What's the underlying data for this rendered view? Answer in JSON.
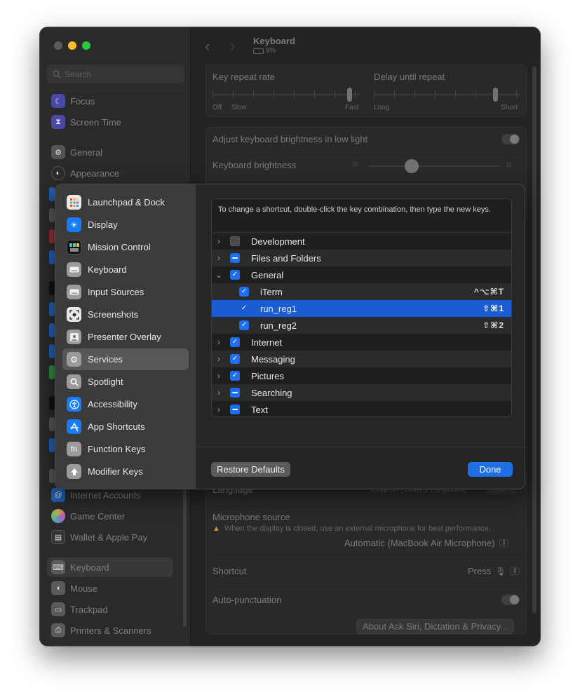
{
  "window": {
    "title": "Keyboard",
    "battery": "9%",
    "search_placeholder": "Search"
  },
  "sidebar": {
    "items": [
      {
        "label": "Focus",
        "icon": "moon-icon",
        "color": "#5e5ce6"
      },
      {
        "label": "Screen Time",
        "icon": "hourglass-icon",
        "color": "#5e5ce6"
      },
      {
        "label": "General",
        "icon": "gear-icon",
        "color": "#8e8e93"
      },
      {
        "label": "Appearance",
        "icon": "appearance-icon",
        "color": "#1c1c1e"
      },
      {
        "label": "Internet Accounts",
        "icon": "at-icon",
        "color": "#0a84ff"
      },
      {
        "label": "Game Center",
        "icon": "game-center-icon",
        "color": "#ff9f0a"
      },
      {
        "label": "Wallet & Apple Pay",
        "icon": "wallet-icon",
        "color": "#1c1c1e"
      },
      {
        "label": "Keyboard",
        "icon": "keyboard-icon",
        "color": "#8e8e93"
      },
      {
        "label": "Mouse",
        "icon": "mouse-icon",
        "color": "#8e8e93"
      },
      {
        "label": "Trackpad",
        "icon": "trackpad-icon",
        "color": "#8e8e93"
      },
      {
        "label": "Printers & Scanners",
        "icon": "printer-icon",
        "color": "#8e8e93"
      }
    ]
  },
  "keyboard": {
    "key_repeat_label": "Key repeat rate",
    "delay_label": "Delay until repeat",
    "repeat_min_1": "Off",
    "repeat_min_2": "Slow",
    "repeat_max": "Fast",
    "delay_min": "Long",
    "delay_max": "Short",
    "key_repeat_rate": 0.93,
    "delay_until_repeat": 0.83,
    "adjust_brightness_label": "Adjust keyboard brightness in low light",
    "adjust_brightness_on": false,
    "brightness_label": "Keyboard brightness",
    "keyboard_brightness": 0.33,
    "language_label": "Language",
    "language_value": "English (United Kingdom)",
    "language_button": "Edit...",
    "mic_source_label": "Microphone source",
    "mic_warning": "When the display is closed, use an external microphone for best performance.",
    "mic_source_value": "Automatic (MacBook Air Microphone)",
    "shortcut_label": "Shortcut",
    "shortcut_value": "Press",
    "auto_punct_label": "Auto-punctuation",
    "auto_punct_on": false,
    "about_button": "About Ask Siri, Dictation & Privacy..."
  },
  "sheet": {
    "categories": [
      {
        "label": "Launchpad & Dock",
        "icon": "launchpad-icon",
        "color": "#e8e8e8"
      },
      {
        "label": "Display",
        "icon": "display-brightness-icon",
        "color": "#1a7cf5"
      },
      {
        "label": "Mission Control",
        "icon": "mission-control-icon",
        "color": "#111111"
      },
      {
        "label": "Keyboard",
        "icon": "keyboard-icon",
        "color": "#9b9b9b"
      },
      {
        "label": "Input Sources",
        "icon": "input-sources-icon",
        "color": "#9b9b9b"
      },
      {
        "label": "Screenshots",
        "icon": "screenshot-icon",
        "color": "#e8e8e8"
      },
      {
        "label": "Presenter Overlay",
        "icon": "presenter-icon",
        "color": "#9b9b9b"
      },
      {
        "label": "Services",
        "icon": "gears-icon",
        "color": "#9b9b9b"
      },
      {
        "label": "Spotlight",
        "icon": "magnifier-icon",
        "color": "#9b9b9b"
      },
      {
        "label": "Accessibility",
        "icon": "accessibility-icon",
        "color": "#1a7cf5"
      },
      {
        "label": "App Shortcuts",
        "icon": "app-store-icon",
        "color": "#1a7cf5"
      },
      {
        "label": "Function Keys",
        "icon": "fn-icon",
        "color": "#9b9b9b"
      },
      {
        "label": "Modifier Keys",
        "icon": "up-arrow-icon",
        "color": "#9b9b9b"
      }
    ],
    "selected_category": "Services",
    "instructions": "To change a shortcut, double-click the key combination, then type the new keys.",
    "rows": [
      {
        "label": "Development",
        "disclosure": "›",
        "check": "off",
        "level": 0,
        "shortcut": ""
      },
      {
        "label": "Files and Folders",
        "disclosure": "›",
        "check": "mixed",
        "level": 0,
        "shortcut": ""
      },
      {
        "label": "General",
        "disclosure": "⌄",
        "check": "on",
        "level": 0,
        "shortcut": ""
      },
      {
        "label": "iTerm",
        "disclosure": "",
        "check": "on",
        "level": 1,
        "shortcut": "^⌥⌘T"
      },
      {
        "label": "run_reg1",
        "disclosure": "",
        "check": "on",
        "level": 1,
        "shortcut": "⇧⌘1",
        "selected": true
      },
      {
        "label": "run_reg2",
        "disclosure": "",
        "check": "on",
        "level": 1,
        "shortcut": "⇧⌘2"
      },
      {
        "label": "Internet",
        "disclosure": "›",
        "check": "on",
        "level": 0,
        "shortcut": ""
      },
      {
        "label": "Messaging",
        "disclosure": "›",
        "check": "on",
        "level": 0,
        "shortcut": ""
      },
      {
        "label": "Pictures",
        "disclosure": "›",
        "check": "on",
        "level": 0,
        "shortcut": ""
      },
      {
        "label": "Searching",
        "disclosure": "›",
        "check": "mixed",
        "level": 0,
        "shortcut": ""
      },
      {
        "label": "Text",
        "disclosure": "›",
        "check": "mixed",
        "level": 0,
        "shortcut": ""
      }
    ],
    "restore_label": "Restore Defaults",
    "done_label": "Done"
  },
  "colors": {
    "accent": "#1c6ff0",
    "selection": "#1a5dd3"
  }
}
